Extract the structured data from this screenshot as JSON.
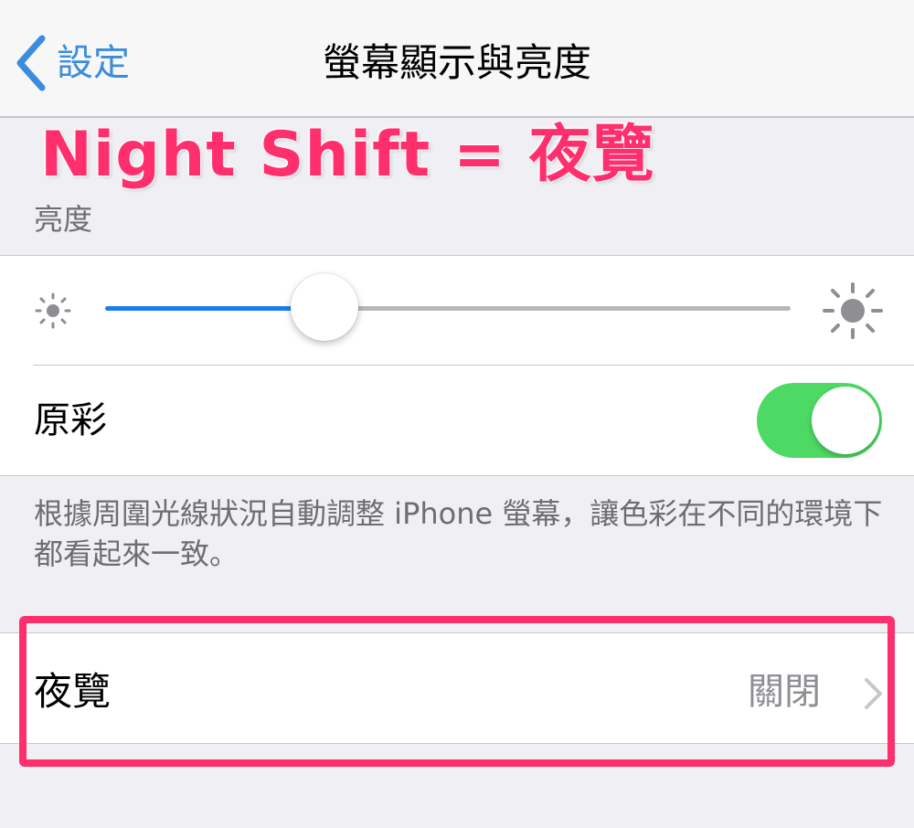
{
  "nav": {
    "back_label": "設定",
    "title": "螢幕顯示與亮度"
  },
  "annotation": {
    "text": "Night Shift = 夜覽",
    "color": "#ff2f6d"
  },
  "brightness": {
    "section_header": "亮度",
    "level_fraction": 0.32,
    "track_color": "#1a7cf0",
    "low_icon": "sun-small-icon",
    "high_icon": "sun-large-icon"
  },
  "true_tone": {
    "label": "原彩",
    "enabled": true,
    "toggle_color": "#4cd964",
    "footer": "根據周圍光線狀況自動調整 iPhone 螢幕，讓色彩在不同的環境下都看起來一致。"
  },
  "night_shift": {
    "label": "夜覽",
    "value": "關閉",
    "chevron_icon": "chevron-right-icon"
  },
  "colors": {
    "tint": "#3b8ddc",
    "background": "#efeff4",
    "secondary_text": "#6d6d72"
  }
}
